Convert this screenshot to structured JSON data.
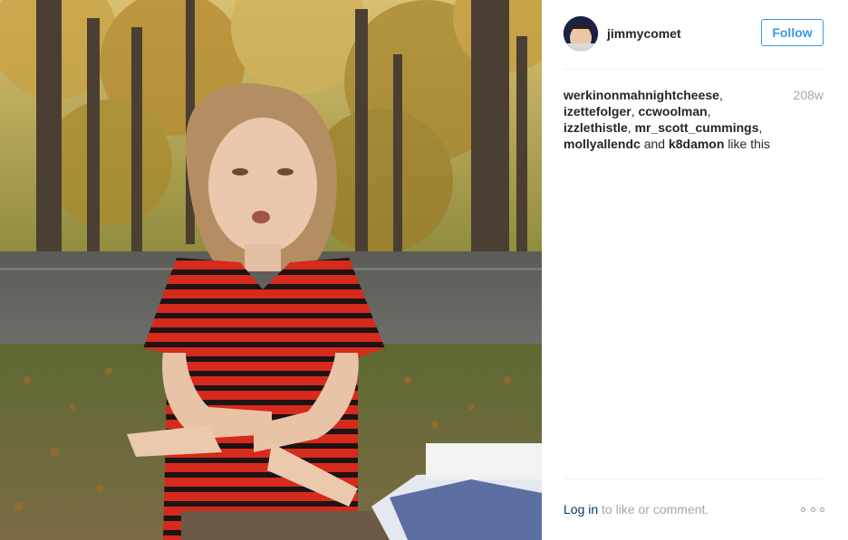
{
  "post": {
    "photo_icon": "post-photo",
    "author": {
      "username": "jimmycomet",
      "avatar_icon": "avatar-image"
    },
    "follow_label": "Follow",
    "timestamp": "208w",
    "likes": {
      "users": [
        "werkinonmahnightcheese",
        "izettefolger",
        "ccwoolman",
        "izzlethistle",
        "mr_scott_cummings",
        "mollyallendc",
        "k8damon"
      ],
      "and_word": "and",
      "suffix": "like this"
    },
    "footer": {
      "login_label": "Log in",
      "login_suffix": "to like or comment.",
      "more_icon": "more-options-icon"
    },
    "colors": {
      "accent": "#3897f0",
      "link": "#003569",
      "muted": "#a5a7aa",
      "divider": "#efefef"
    }
  }
}
